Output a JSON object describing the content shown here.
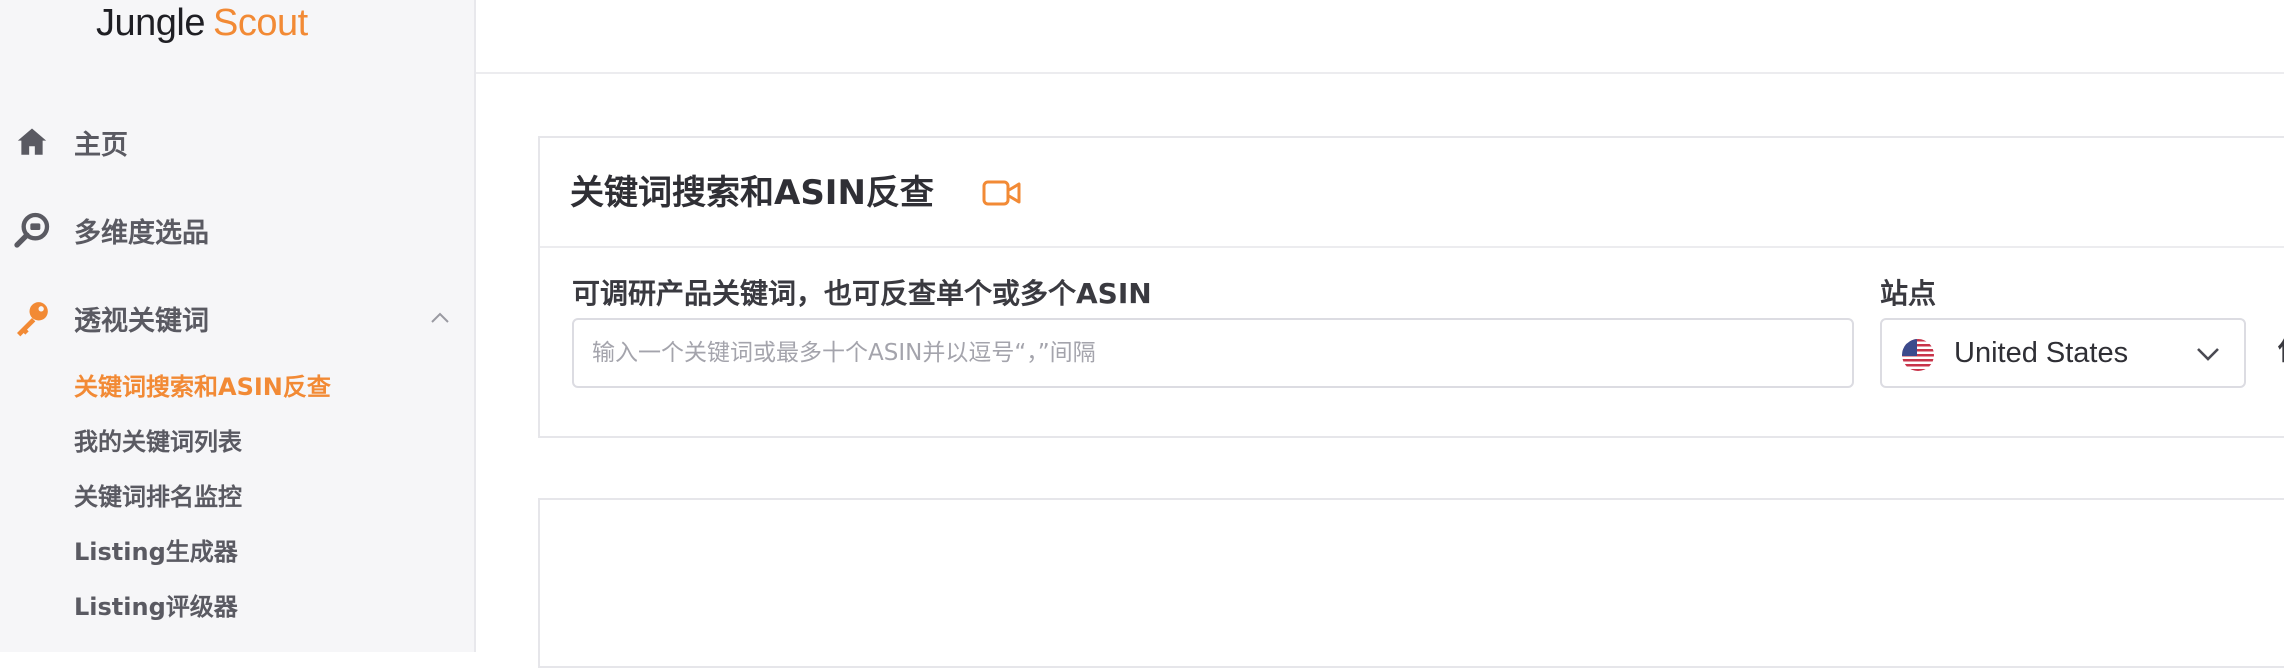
{
  "brand": {
    "part1": "Jungle",
    "part2": "Scout"
  },
  "sidebar": {
    "items": [
      {
        "label": "主页",
        "icon": "home-icon"
      },
      {
        "label": "多维度选品",
        "icon": "search-icon"
      },
      {
        "label": "透视关键词",
        "icon": "key-icon",
        "expanded": true
      }
    ],
    "subitems": [
      {
        "label": "关键词搜索和ASIN反查",
        "active": true
      },
      {
        "label": "我的关键词列表"
      },
      {
        "label": "关键词排名监控"
      },
      {
        "label": "Listing生成器"
      },
      {
        "label": "Listing评级器"
      }
    ]
  },
  "main": {
    "card_title": "关键词搜索和ASIN反查",
    "keyword_label": "可调研产品关键词，也可反查单个或多个ASIN",
    "keyword_input": {
      "value": "",
      "placeholder": "输入一个关键词或最多十个ASIN并以逗号“，”间隔"
    },
    "site_label": "站点",
    "site_value": "United States",
    "cut_label": "使"
  },
  "colors": {
    "accent": "#f28a35",
    "sidebar_bg": "#f6f6f8",
    "icon_gray": "#5a5a62"
  }
}
